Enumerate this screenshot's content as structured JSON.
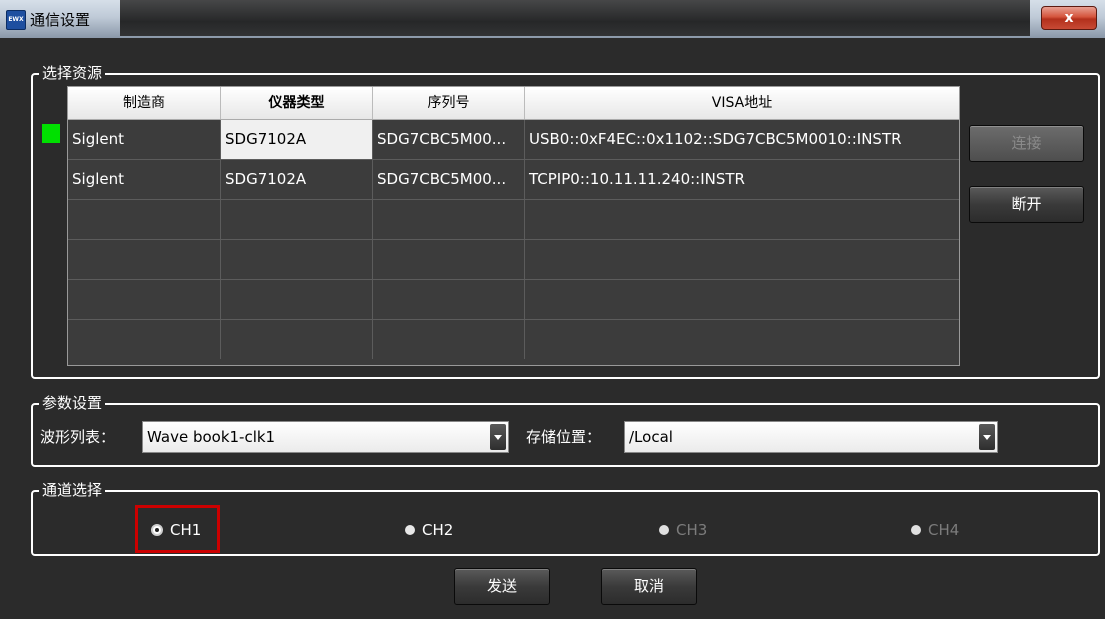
{
  "window": {
    "title": "通信设置",
    "icon_label": "EWX",
    "close_label": "x"
  },
  "resource": {
    "group_label": "选择资源",
    "columns": [
      "制造商",
      "仪器类型",
      "序列号",
      "VISA地址"
    ],
    "rows": [
      {
        "manufacturer": "Siglent",
        "type": "SDG7102A",
        "serial": "SDG7CBC5M00...",
        "visa": "USB0::0xF4EC::0x1102::SDG7CBC5M0010::INSTR"
      },
      {
        "manufacturer": "Siglent",
        "type": "SDG7102A",
        "serial": "SDG7CBC5M00...",
        "visa": "TCPIP0::10.11.11.240::INSTR"
      }
    ],
    "connect_label": "连接",
    "disconnect_label": "断开",
    "indicator_color": "#00e000"
  },
  "params": {
    "group_label": "参数设置",
    "wave_label": "波形列表：",
    "wave_value": "Wave book1-clk1",
    "store_label": "存储位置：",
    "store_value": "/Local"
  },
  "channels": {
    "group_label": "通道选择",
    "items": [
      {
        "label": "CH1",
        "checked": true,
        "enabled": true
      },
      {
        "label": "CH2",
        "checked": false,
        "enabled": true
      },
      {
        "label": "CH3",
        "checked": false,
        "enabled": false
      },
      {
        "label": "CH4",
        "checked": false,
        "enabled": false
      }
    ],
    "highlight_color": "#cc0000"
  },
  "actions": {
    "send_label": "发送",
    "cancel_label": "取消"
  }
}
